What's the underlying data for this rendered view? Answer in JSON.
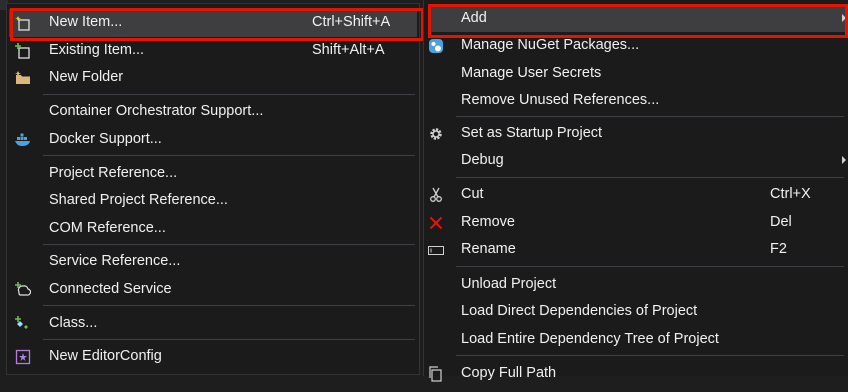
{
  "submenu": {
    "items": [
      {
        "label": "New Item...",
        "shortcut": "Ctrl+Shift+A",
        "icon": "new-item-icon"
      },
      {
        "label": "Existing Item...",
        "shortcut": "Shift+Alt+A",
        "icon": "existing-item-icon"
      },
      {
        "label": "New Folder",
        "shortcut": "",
        "icon": "folder-icon"
      },
      {
        "label": "Container Orchestrator Support...",
        "shortcut": "",
        "icon": ""
      },
      {
        "label": "Docker Support...",
        "shortcut": "",
        "icon": "docker-icon"
      },
      {
        "label": "Project Reference...",
        "shortcut": "",
        "icon": ""
      },
      {
        "label": "Shared Project Reference...",
        "shortcut": "",
        "icon": ""
      },
      {
        "label": "COM Reference...",
        "shortcut": "",
        "icon": ""
      },
      {
        "label": "Service Reference...",
        "shortcut": "",
        "icon": ""
      },
      {
        "label": "Connected Service",
        "shortcut": "",
        "icon": "connected-service-icon"
      },
      {
        "label": "Class...",
        "shortcut": "",
        "icon": "class-icon"
      },
      {
        "label": "New EditorConfig",
        "shortcut": "",
        "icon": "editorconfig-icon"
      }
    ]
  },
  "context_menu": {
    "items": [
      {
        "label": "Add",
        "shortcut": "",
        "icon": ""
      },
      {
        "label": "Manage NuGet Packages...",
        "shortcut": "",
        "icon": "nuget-icon"
      },
      {
        "label": "Manage User Secrets",
        "shortcut": "",
        "icon": ""
      },
      {
        "label": "Remove Unused References...",
        "shortcut": "",
        "icon": ""
      },
      {
        "label": "Set as Startup Project",
        "shortcut": "",
        "icon": "gear-icon"
      },
      {
        "label": "Debug",
        "shortcut": "",
        "icon": ""
      },
      {
        "label": "Cut",
        "shortcut": "Ctrl+X",
        "icon": "scissors-icon"
      },
      {
        "label": "Remove",
        "shortcut": "Del",
        "icon": "close-icon"
      },
      {
        "label": "Rename",
        "shortcut": "F2",
        "icon": "rename-icon"
      },
      {
        "label": "Unload Project",
        "shortcut": "",
        "icon": ""
      },
      {
        "label": "Load Direct Dependencies of Project",
        "shortcut": "",
        "icon": ""
      },
      {
        "label": "Load Entire Dependency Tree of Project",
        "shortcut": "",
        "icon": ""
      },
      {
        "label": "Copy Full Path",
        "shortcut": "",
        "icon": "copy-icon"
      }
    ]
  },
  "colors": {
    "menu_bg": "#1b1b1c",
    "hover_bg": "#3e3e40",
    "highlight_border": "#e51400",
    "separator": "#3f3f46",
    "text": "#f1f1f1"
  }
}
